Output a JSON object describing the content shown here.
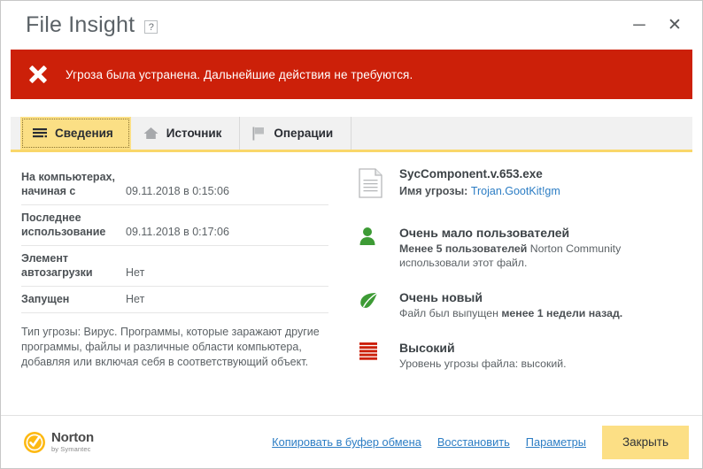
{
  "window": {
    "title": "File Insight",
    "help_label": "?",
    "minimize_label": "─",
    "close_label": "✕"
  },
  "banner": {
    "icon": "x-mark-icon",
    "color": "#cc2009",
    "message": "Угроза была устранена. Дальнейшие действия не требуются."
  },
  "tabs": [
    {
      "label": "Сведения",
      "icon": "list-lines-icon",
      "active": true
    },
    {
      "label": "Источник",
      "icon": "home-icon",
      "active": false
    },
    {
      "label": "Операции",
      "icon": "flag-icon",
      "active": false
    }
  ],
  "details": {
    "rows": [
      {
        "label": "На компьютерах, начиная с",
        "value": "09.11.2018 в 0:15:06"
      },
      {
        "label": "Последнее использование",
        "value": "09.11.2018 в 0:17:06"
      },
      {
        "label": "Элемент автозагрузки",
        "value": "Нет"
      },
      {
        "label": "Запущен",
        "value": "Нет"
      }
    ],
    "description": "Тип угрозы: Вирус. Программы, которые заражают другие программы, файлы и различные области компьютера, добавляя или включая себя в соответствующий объект."
  },
  "file": {
    "icon": "document-icon",
    "name": "SycComponent.v.653.exe",
    "threat_label": "Имя угрозы:",
    "threat_name": "Trojan.GootKit!gm"
  },
  "reputation": [
    {
      "icon": "user-icon",
      "icon_color": "#3d9b35",
      "title": "Очень мало пользователей",
      "sub_bold": "Менее 5 пользователей",
      "sub_rest": " Norton Community использовали этот файл."
    },
    {
      "icon": "leaf-icon",
      "icon_color": "#3d9b35",
      "title": "Очень новый",
      "sub_pre": "Файл был выпущен ",
      "sub_bold": "менее 1 недели назад.",
      "sub_rest": ""
    },
    {
      "icon": "threat-bars-icon",
      "icon_color": "#cc2009",
      "title": "Высокий",
      "sub_pre": "Уровень угрозы файла: высокий.",
      "sub_bold": "",
      "sub_rest": ""
    }
  ],
  "footer": {
    "logo_name": "Norton",
    "logo_tagline": "by Symantec",
    "links": [
      "Копировать в буфер обмена",
      "Восстановить",
      "Параметры"
    ],
    "close_button": "Закрыть"
  },
  "colors": {
    "danger": "#cc2009",
    "accent_yellow": "#fcdf85",
    "link_blue": "#2c7dc4",
    "good_green": "#3d9b35"
  }
}
